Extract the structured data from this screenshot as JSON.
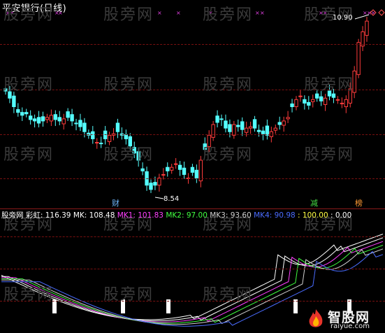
{
  "title": "平安银行(日线)",
  "watermark_text": "股旁网",
  "price_high_label": "10.90",
  "price_low_label": "8.54",
  "tags": {
    "cai": "财",
    "jian": "减",
    "bang": "榜"
  },
  "indicator": {
    "source": "股旁网",
    "name": "彩虹",
    "v0": ": 116.39",
    "mk": "MK: 108.48",
    "mk1": "MK1: 101.83",
    "mk2": "MK2: 97.00",
    "mk3": "MK3: 93.60",
    "mk4": "MK4: 90.98",
    "hundred": ": 100.00",
    "zero": ": 0.00"
  },
  "logo": {
    "title": "智股网",
    "url": "raiyue.com"
  },
  "colors": {
    "up": "#ff3c3c",
    "down": "#54ffff",
    "mk": "#ffffff",
    "mk1": "#ff40ff",
    "mk2": "#40ff40",
    "mk3": "#d0d0d0",
    "mk4": "#4a6cff",
    "hundred": "#ffff44",
    "cai": "#6fb8ff",
    "jian": "#44dd44",
    "bang": "#ff9a33"
  }
}
